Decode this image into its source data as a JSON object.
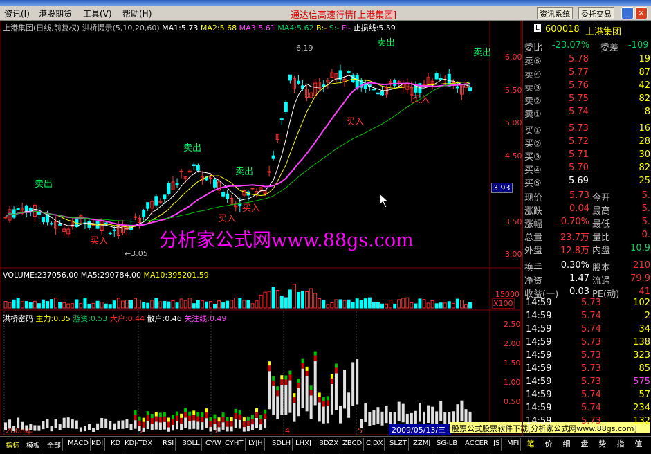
{
  "menu": {
    "items": [
      "资讯(I)",
      "港股期货",
      "工具(V)",
      "帮助(H)"
    ],
    "app_title": "通达信高速行情",
    "app_title_brand": "[上港集团]",
    "btn_news": "资讯系统",
    "btn_trade": "委托交易"
  },
  "chart": {
    "title": "上港集团(日线,前复权)",
    "indicator": "洪桥提示(5,10,20,60)",
    "ma1": "MA1:5.73",
    "ma2": "MA2:5.68",
    "ma3": "MA3:5.61",
    "ma4": "MA4:5.62",
    "b": "B:-",
    "s": "S:-",
    "f": "F:-",
    "stop": "止损线:5.59",
    "price_ticks": [
      "6.00",
      "5.50",
      "5.00",
      "4.50",
      "3.50",
      "3.00"
    ],
    "cursor_price": "3.93",
    "low_label": "3.05",
    "high_label": "6.19",
    "sell_label": "卖出",
    "buy_label": "买入",
    "vol_title": "VOLUME:237056.00",
    "vol_ma5": "MA5:290784.00",
    "vol_ma10": "MA10:395201.59",
    "vol_tick": "15000",
    "vol_unit": "X100",
    "ind_title": "洪桥密码",
    "ind_main": "主力:0.35",
    "ind_you": "游资:0.53",
    "ind_big": "大户:0.44",
    "ind_small": "散户:0.46",
    "ind_focus": "关注线:0.49",
    "ind_ticks": [
      "2.50",
      "2.00",
      "1.50",
      "1.00",
      "0.50"
    ],
    "months": [
      "2008年",
      "2",
      "3",
      "4",
      "5"
    ],
    "date": "2009/05/13/三",
    "watermark": "分析家公式网www.88gs.com",
    "ad": "股票公式股票软件下载[分析家公式网www.88gs.com]"
  },
  "quote": {
    "code": "600018",
    "name": "上港集团",
    "weibi_label": "委比",
    "weibi": "-23.07%",
    "weicha_label": "委差",
    "weicha": "-109",
    "asks": [
      {
        "l": "卖⑤",
        "p": "5.78",
        "v": "19"
      },
      {
        "l": "卖④",
        "p": "5.77",
        "v": "87"
      },
      {
        "l": "卖③",
        "p": "5.76",
        "v": "42"
      },
      {
        "l": "卖②",
        "p": "5.75",
        "v": "82"
      },
      {
        "l": "卖①",
        "p": "5.74",
        "v": "8"
      }
    ],
    "bids": [
      {
        "l": "买①",
        "p": "5.73",
        "v": "16"
      },
      {
        "l": "买②",
        "p": "5.72",
        "v": "28"
      },
      {
        "l": "买③",
        "p": "5.71",
        "v": "30"
      },
      {
        "l": "买④",
        "p": "5.70",
        "v": "82"
      },
      {
        "l": "买⑤",
        "p": "5.69",
        "v": "25"
      }
    ],
    "stats": [
      {
        "a": "现价",
        "av": "5.73",
        "b": "今开",
        "bv": "5."
      },
      {
        "a": "涨跌",
        "av": "0.04",
        "b": "最高",
        "bv": "5."
      },
      {
        "a": "涨幅",
        "av": "0.70%",
        "b": "最低",
        "bv": "5."
      },
      {
        "a": "总量",
        "av": "23.7万",
        "b": "量比",
        "bv": "0."
      },
      {
        "a": "外盘",
        "av": "12.8万",
        "b": "内盘",
        "bv": "10.9"
      },
      {
        "a": "换手",
        "av": "0.30%",
        "b": "股本",
        "bv": "210"
      },
      {
        "a": "净资",
        "av": "1.47",
        "b": "流通",
        "bv": "79.9"
      },
      {
        "a": "收益(一)",
        "av": "0.03",
        "b": "PE(动)",
        "bv": "41"
      }
    ],
    "ticks": [
      {
        "t": "14:59",
        "p": "5.73",
        "v": "102"
      },
      {
        "t": "14:59",
        "p": "5.74",
        "v": "2"
      },
      {
        "t": "14:59",
        "p": "5.74",
        "v": "34"
      },
      {
        "t": "14:59",
        "p": "5.73",
        "v": "138"
      },
      {
        "t": "14:59",
        "p": "5.73",
        "v": "323"
      },
      {
        "t": "14:59",
        "p": "5.73",
        "v": "85"
      },
      {
        "t": "14:59",
        "p": "5.73",
        "v": "575"
      },
      {
        "t": "14:59",
        "p": "5.74",
        "v": "57"
      },
      {
        "t": "14:59",
        "p": "5.74",
        "v": "234"
      },
      {
        "t": "14:59",
        "p": "5.73",
        "v": "132"
      }
    ]
  },
  "tabs": [
    "指标",
    "模板",
    "全部",
    "MACD",
    "KDJ",
    "KD",
    "KDJ-TDX",
    "RSI",
    "BOLL",
    "CYW",
    "CYHT",
    "LYJH",
    "SDLH",
    "LHXJ",
    "BDZX",
    "ZBCD",
    "CJDX",
    "SLZT",
    "ZZMJ",
    "SG-LB",
    "ACCER",
    "JS",
    "MFI"
  ],
  "right_tabs": [
    "笔",
    "价",
    "细",
    "盘",
    "势",
    "指",
    "值"
  ]
}
